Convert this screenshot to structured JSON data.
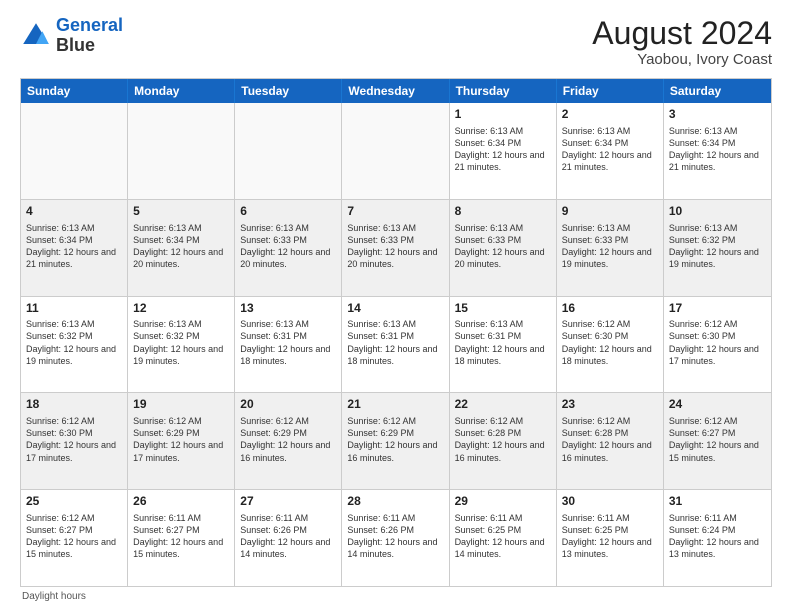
{
  "header": {
    "logo_line1": "General",
    "logo_line2": "Blue",
    "main_title": "August 2024",
    "subtitle": "Yaobou, Ivory Coast"
  },
  "days_of_week": [
    "Sunday",
    "Monday",
    "Tuesday",
    "Wednesday",
    "Thursday",
    "Friday",
    "Saturday"
  ],
  "footer_note": "Daylight hours",
  "weeks": [
    [
      {
        "day": "",
        "empty": true
      },
      {
        "day": "",
        "empty": true
      },
      {
        "day": "",
        "empty": true
      },
      {
        "day": "",
        "empty": true
      },
      {
        "day": "1",
        "sunrise": "6:13 AM",
        "sunset": "6:34 PM",
        "daylight": "12 hours and 21 minutes."
      },
      {
        "day": "2",
        "sunrise": "6:13 AM",
        "sunset": "6:34 PM",
        "daylight": "12 hours and 21 minutes."
      },
      {
        "day": "3",
        "sunrise": "6:13 AM",
        "sunset": "6:34 PM",
        "daylight": "12 hours and 21 minutes."
      }
    ],
    [
      {
        "day": "4",
        "sunrise": "6:13 AM",
        "sunset": "6:34 PM",
        "daylight": "12 hours and 21 minutes."
      },
      {
        "day": "5",
        "sunrise": "6:13 AM",
        "sunset": "6:34 PM",
        "daylight": "12 hours and 20 minutes."
      },
      {
        "day": "6",
        "sunrise": "6:13 AM",
        "sunset": "6:33 PM",
        "daylight": "12 hours and 20 minutes."
      },
      {
        "day": "7",
        "sunrise": "6:13 AM",
        "sunset": "6:33 PM",
        "daylight": "12 hours and 20 minutes."
      },
      {
        "day": "8",
        "sunrise": "6:13 AM",
        "sunset": "6:33 PM",
        "daylight": "12 hours and 20 minutes."
      },
      {
        "day": "9",
        "sunrise": "6:13 AM",
        "sunset": "6:33 PM",
        "daylight": "12 hours and 19 minutes."
      },
      {
        "day": "10",
        "sunrise": "6:13 AM",
        "sunset": "6:32 PM",
        "daylight": "12 hours and 19 minutes."
      }
    ],
    [
      {
        "day": "11",
        "sunrise": "6:13 AM",
        "sunset": "6:32 PM",
        "daylight": "12 hours and 19 minutes."
      },
      {
        "day": "12",
        "sunrise": "6:13 AM",
        "sunset": "6:32 PM",
        "daylight": "12 hours and 19 minutes."
      },
      {
        "day": "13",
        "sunrise": "6:13 AM",
        "sunset": "6:31 PM",
        "daylight": "12 hours and 18 minutes."
      },
      {
        "day": "14",
        "sunrise": "6:13 AM",
        "sunset": "6:31 PM",
        "daylight": "12 hours and 18 minutes."
      },
      {
        "day": "15",
        "sunrise": "6:13 AM",
        "sunset": "6:31 PM",
        "daylight": "12 hours and 18 minutes."
      },
      {
        "day": "16",
        "sunrise": "6:12 AM",
        "sunset": "6:30 PM",
        "daylight": "12 hours and 18 minutes."
      },
      {
        "day": "17",
        "sunrise": "6:12 AM",
        "sunset": "6:30 PM",
        "daylight": "12 hours and 17 minutes."
      }
    ],
    [
      {
        "day": "18",
        "sunrise": "6:12 AM",
        "sunset": "6:30 PM",
        "daylight": "12 hours and 17 minutes."
      },
      {
        "day": "19",
        "sunrise": "6:12 AM",
        "sunset": "6:29 PM",
        "daylight": "12 hours and 17 minutes."
      },
      {
        "day": "20",
        "sunrise": "6:12 AM",
        "sunset": "6:29 PM",
        "daylight": "12 hours and 16 minutes."
      },
      {
        "day": "21",
        "sunrise": "6:12 AM",
        "sunset": "6:29 PM",
        "daylight": "12 hours and 16 minutes."
      },
      {
        "day": "22",
        "sunrise": "6:12 AM",
        "sunset": "6:28 PM",
        "daylight": "12 hours and 16 minutes."
      },
      {
        "day": "23",
        "sunrise": "6:12 AM",
        "sunset": "6:28 PM",
        "daylight": "12 hours and 16 minutes."
      },
      {
        "day": "24",
        "sunrise": "6:12 AM",
        "sunset": "6:27 PM",
        "daylight": "12 hours and 15 minutes."
      }
    ],
    [
      {
        "day": "25",
        "sunrise": "6:12 AM",
        "sunset": "6:27 PM",
        "daylight": "12 hours and 15 minutes."
      },
      {
        "day": "26",
        "sunrise": "6:11 AM",
        "sunset": "6:27 PM",
        "daylight": "12 hours and 15 minutes."
      },
      {
        "day": "27",
        "sunrise": "6:11 AM",
        "sunset": "6:26 PM",
        "daylight": "12 hours and 14 minutes."
      },
      {
        "day": "28",
        "sunrise": "6:11 AM",
        "sunset": "6:26 PM",
        "daylight": "12 hours and 14 minutes."
      },
      {
        "day": "29",
        "sunrise": "6:11 AM",
        "sunset": "6:25 PM",
        "daylight": "12 hours and 14 minutes."
      },
      {
        "day": "30",
        "sunrise": "6:11 AM",
        "sunset": "6:25 PM",
        "daylight": "12 hours and 13 minutes."
      },
      {
        "day": "31",
        "sunrise": "6:11 AM",
        "sunset": "6:24 PM",
        "daylight": "12 hours and 13 minutes."
      }
    ]
  ]
}
